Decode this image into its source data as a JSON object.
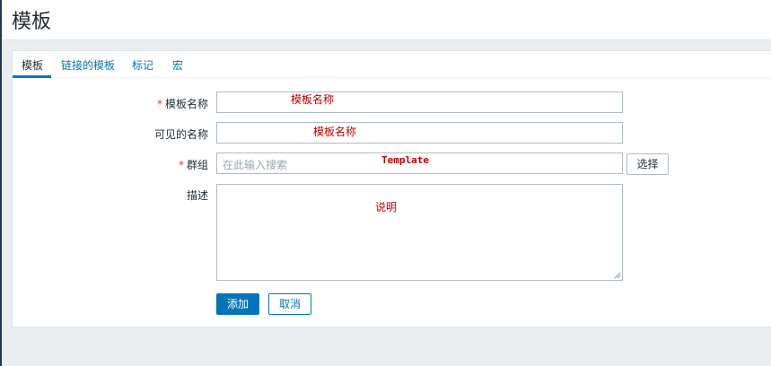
{
  "page": {
    "title": "模板"
  },
  "tabs": [
    {
      "label": "模板",
      "active": true
    },
    {
      "label": "链接的模板",
      "active": false
    },
    {
      "label": "标记",
      "active": false
    },
    {
      "label": "宏",
      "active": false
    }
  ],
  "form": {
    "required_mark": "*",
    "template_name": {
      "label": "模板名称",
      "annotation": "模板名称"
    },
    "visible_name": {
      "label": "可见的名称",
      "annotation": "模板名称"
    },
    "groups": {
      "label": "群组",
      "placeholder": "在此输入搜索",
      "annotation": "Template",
      "select_label": "选择"
    },
    "description": {
      "label": "描述",
      "annotation": "说明"
    }
  },
  "actions": {
    "add_label": "添加",
    "cancel_label": "取消"
  },
  "colors": {
    "accent": "#0275b8",
    "required": "#e33734",
    "annotation": "#c00000",
    "background": "#ebeef0"
  }
}
